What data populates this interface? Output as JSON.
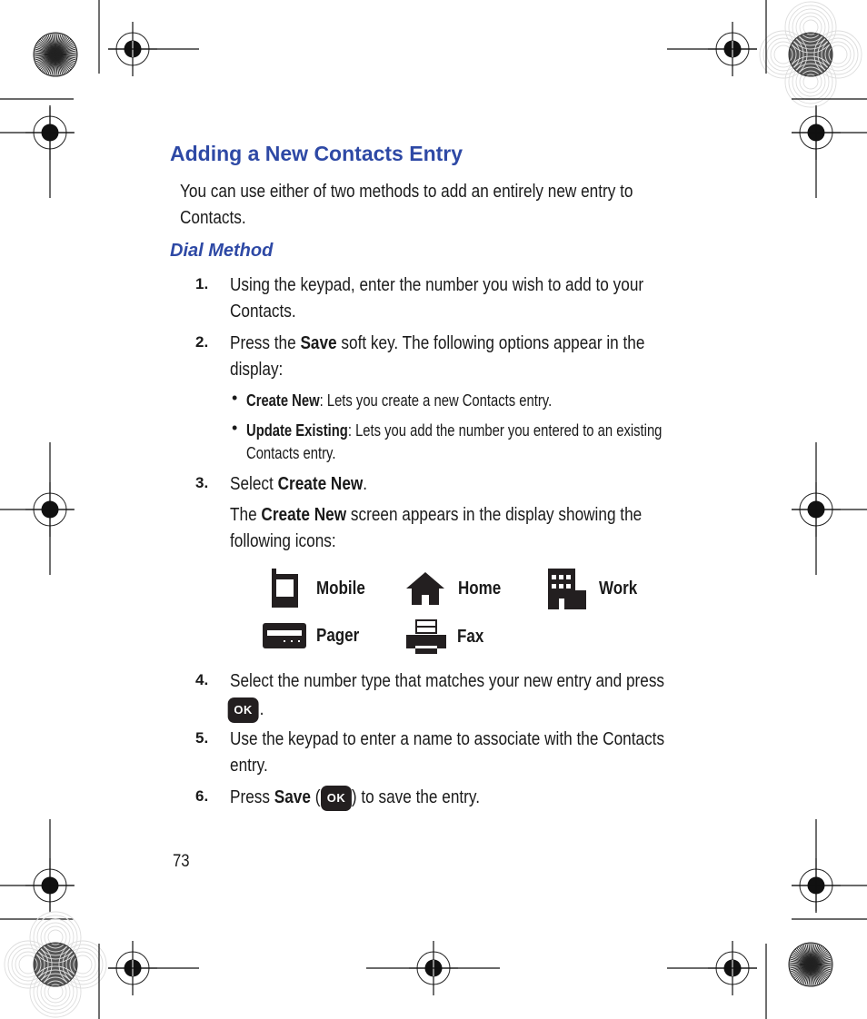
{
  "page": {
    "heading": "Adding a New Contacts Entry",
    "intro_line1": "You can use either of two methods to add an entirely new entry to",
    "intro_line2": "Contacts.",
    "subheading": "Dial Method",
    "page_number": "73"
  },
  "steps": [
    {
      "num": "1.",
      "line1": "Using the keypad, enter the number you wish to add to your",
      "line2": "Contacts."
    },
    {
      "num": "2.",
      "pre": "Press the ",
      "bold": "Save",
      "post": " soft key. The following options appear in the",
      "line2": "display:"
    },
    {
      "num": "3.",
      "pre": "Select ",
      "bold": "Create New",
      "post": ".",
      "para_pre": "The ",
      "para_bold": "Create New",
      "para_post": " screen appears in the display showing the",
      "para_line2": "following icons:"
    },
    {
      "num": "4.",
      "line1": "Select the number type that matches your new entry and press",
      "post_key": "."
    },
    {
      "num": "5.",
      "line1": "Use the keypad to enter a name to associate with the Contacts",
      "line2": "entry."
    },
    {
      "num": "6.",
      "pre": "Press ",
      "bold": "Save",
      "mid": " (",
      "post": ") to save the entry."
    }
  ],
  "bullets": [
    {
      "bold": "Create New",
      "text": ": Lets you create a new Contacts entry."
    },
    {
      "bold": "Update Existing",
      "text": ": Lets you add the number you entered to an existing",
      "line2": "Contacts entry."
    }
  ],
  "bullet_glyph": "•",
  "number_types": [
    {
      "icon": "mobile-icon",
      "label": "Mobile"
    },
    {
      "icon": "home-icon",
      "label": "Home"
    },
    {
      "icon": "work-icon",
      "label": "Work"
    },
    {
      "icon": "pager-icon",
      "label": "Pager"
    },
    {
      "icon": "fax-icon",
      "label": "Fax"
    }
  ],
  "ok_key_label": "OK",
  "colors": {
    "heading": "#2e49a5",
    "text": "#1a1a1a",
    "key": "#231f20"
  }
}
